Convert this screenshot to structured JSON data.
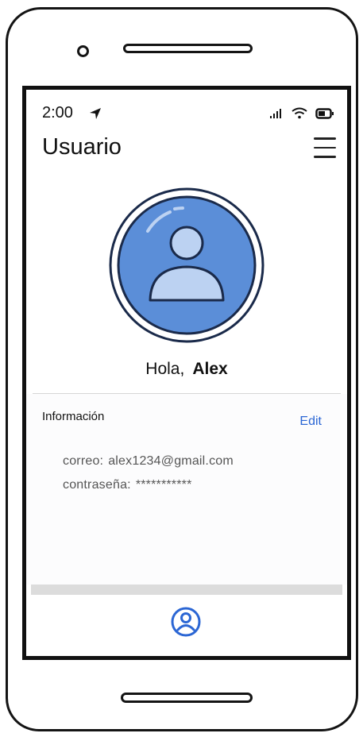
{
  "status_bar": {
    "time": "2:00"
  },
  "header": {
    "title": "Usuario"
  },
  "greeting": {
    "prefix": "Hola,",
    "name": "Alex"
  },
  "info": {
    "title": "Información",
    "edit_label": "Edit",
    "email_label": "correo:",
    "email_value": "alex1234@gmail.com",
    "password_label": "contraseña:",
    "password_value": "***********"
  },
  "colors": {
    "accent": "#2b66d4",
    "avatar_fill": "#5b8ed8",
    "avatar_light": "#bcd2f2",
    "outline": "#1a2a4a"
  },
  "icons": [
    "location-arrow-icon",
    "signal-icon",
    "wifi-icon",
    "battery-icon",
    "menu-icon",
    "user-avatar-icon",
    "profile-tab-icon"
  ]
}
